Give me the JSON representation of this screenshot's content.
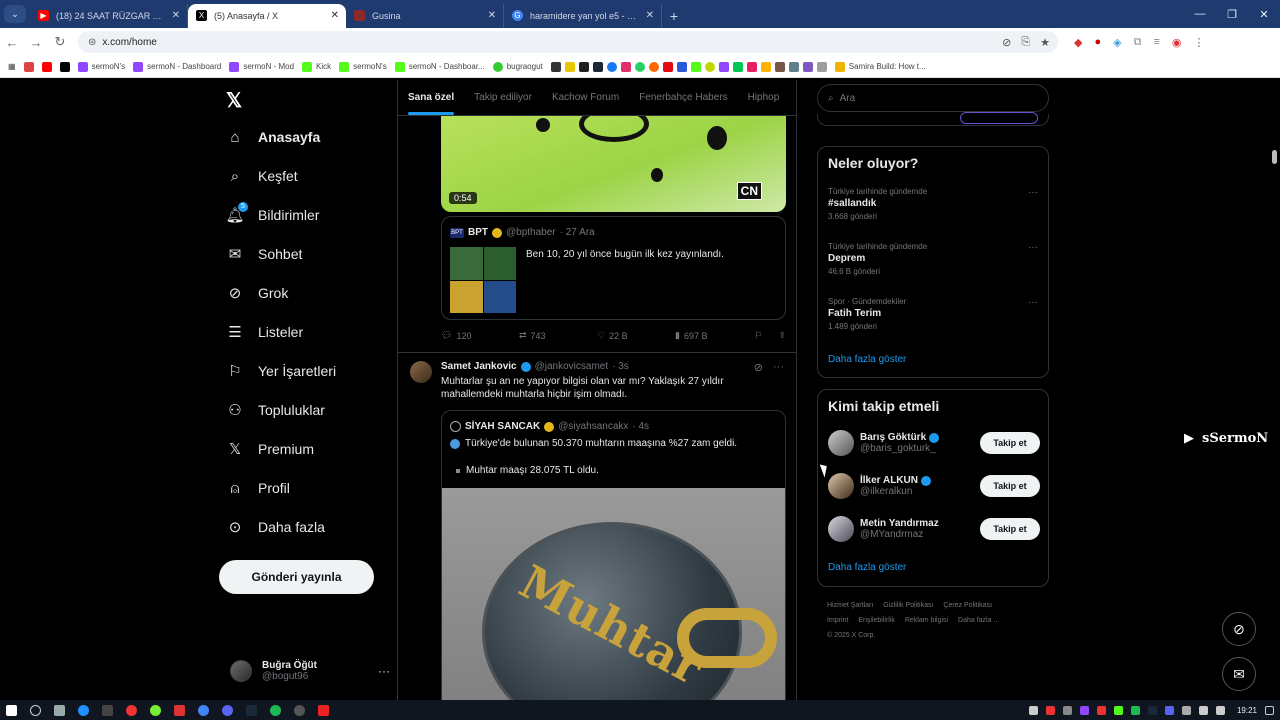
{
  "browser": {
    "tabs": [
      {
        "title": "(18) 24 SAAT RÜZGAR TÜRBİNİ",
        "color": "#ff0000",
        "active": false
      },
      {
        "title": "(5) Anasayfa / X",
        "color": "#000000",
        "active": true
      },
      {
        "title": "Gusina",
        "color": "#8a2a2a",
        "active": false
      },
      {
        "title": "haramidere yan yol e5 - Google",
        "color": "#4285f4",
        "active": false
      }
    ],
    "url": "x.com/home",
    "bookmarks": [
      "sermoN's",
      "sermoN - Dashboard",
      "sermoN - Mod",
      "Kick",
      "sermoN's",
      "sermoN - Dashboar...",
      "bugraogut",
      "Samira Build: How t..."
    ]
  },
  "nav": {
    "items": [
      {
        "label": "Anasayfa",
        "icon": "home-icon"
      },
      {
        "label": "Keşfet",
        "icon": "search-icon"
      },
      {
        "label": "Bildirimler",
        "icon": "bell-icon"
      },
      {
        "label": "Sohbet",
        "icon": "mail-icon"
      },
      {
        "label": "Grok",
        "icon": "grok-icon"
      },
      {
        "label": "Listeler",
        "icon": "list-icon"
      },
      {
        "label": "Yer İşaretleri",
        "icon": "bookmark-icon"
      },
      {
        "label": "Topluluklar",
        "icon": "people-icon"
      },
      {
        "label": "Premium",
        "icon": "x-icon"
      },
      {
        "label": "Profil",
        "icon": "person-icon"
      },
      {
        "label": "Daha fazla",
        "icon": "more-icon"
      }
    ],
    "notification_badge": "5",
    "post_button": "Gönderi yayınla",
    "profile": {
      "name": "Buğra Öğüt",
      "handle": "@bogut96"
    }
  },
  "timeline": {
    "tabs": [
      "Sana özel",
      "Takip ediliyor",
      "Kachow Forum",
      "Fenerbahçe Habers",
      "Hiphop"
    ],
    "video": {
      "duration": "0:54",
      "watermark": "CN"
    },
    "quote_bpt": {
      "name": "BPT",
      "handle": "@bpthaber",
      "date": "· 27 Ara",
      "logo": "BPT",
      "text": "Ben 10, 20 yıl önce bugün ilk kez yayınlandı."
    },
    "actions1": {
      "replies": "120",
      "reposts": "743",
      "likes": "22 B",
      "views": "697 B"
    },
    "tweet2": {
      "name": "Samet Jankovic",
      "handle": "@jankovicsamet",
      "time": "· 3s",
      "text": "Muhtarlar şu an ne yapıyor bilgisi olan var mı? Yaklaşık 27 yıldır mahallemdeki muhtarla hiçbir işim olmadı.",
      "quote": {
        "name": "SİYAH SANCAK",
        "handle": "@siyahsancakx",
        "time": "· 4s",
        "line1": "Türkiye'de bulunan 50.370 muhtarın maaşına %27 zam geldi.",
        "line2": "Muhtar maaşı 28.075 TL oldu.",
        "image_text": "Muhtar"
      }
    }
  },
  "sidebar": {
    "search_placeholder": "Ara",
    "trends_title": "Neler oluyor?",
    "trends": [
      {
        "context": "Türkiye tarihinde gündemde",
        "name": "#sallandık",
        "count": "3.668 gönderi"
      },
      {
        "context": "Türkiye tarihinde gündemde",
        "name": "Deprem",
        "count": "46,6 B gönderi"
      },
      {
        "context": "Spor · Gündemdekiler",
        "name": "Fatih Terim",
        "count": "1.489 gönderi"
      }
    ],
    "show_more": "Daha fazla göster",
    "who_title": "Kimi takip etmeli",
    "who": [
      {
        "name": "Barış Göktürk",
        "handle": "@baris_gokturk_",
        "button": "Takip et"
      },
      {
        "name": "İlker ALKUN",
        "handle": "@ilkeralkun",
        "button": "Takip et"
      },
      {
        "name": "Metin Yandırmaz",
        "handle": "@MYandrmaz",
        "button": "Takip et"
      }
    ],
    "who_more": "Daha fazla göster",
    "footer": [
      "Hizmet Şartları",
      "Gizlilik Politikası",
      "Çerez Politikası",
      "Imprint",
      "Erişilebilirlik",
      "Reklam bilgisi",
      "Daha fazla ...",
      "© 2025 X Corp."
    ]
  },
  "overlay": {
    "stream_tag": "sSermoN"
  },
  "taskbar": {
    "time": "19:21"
  }
}
